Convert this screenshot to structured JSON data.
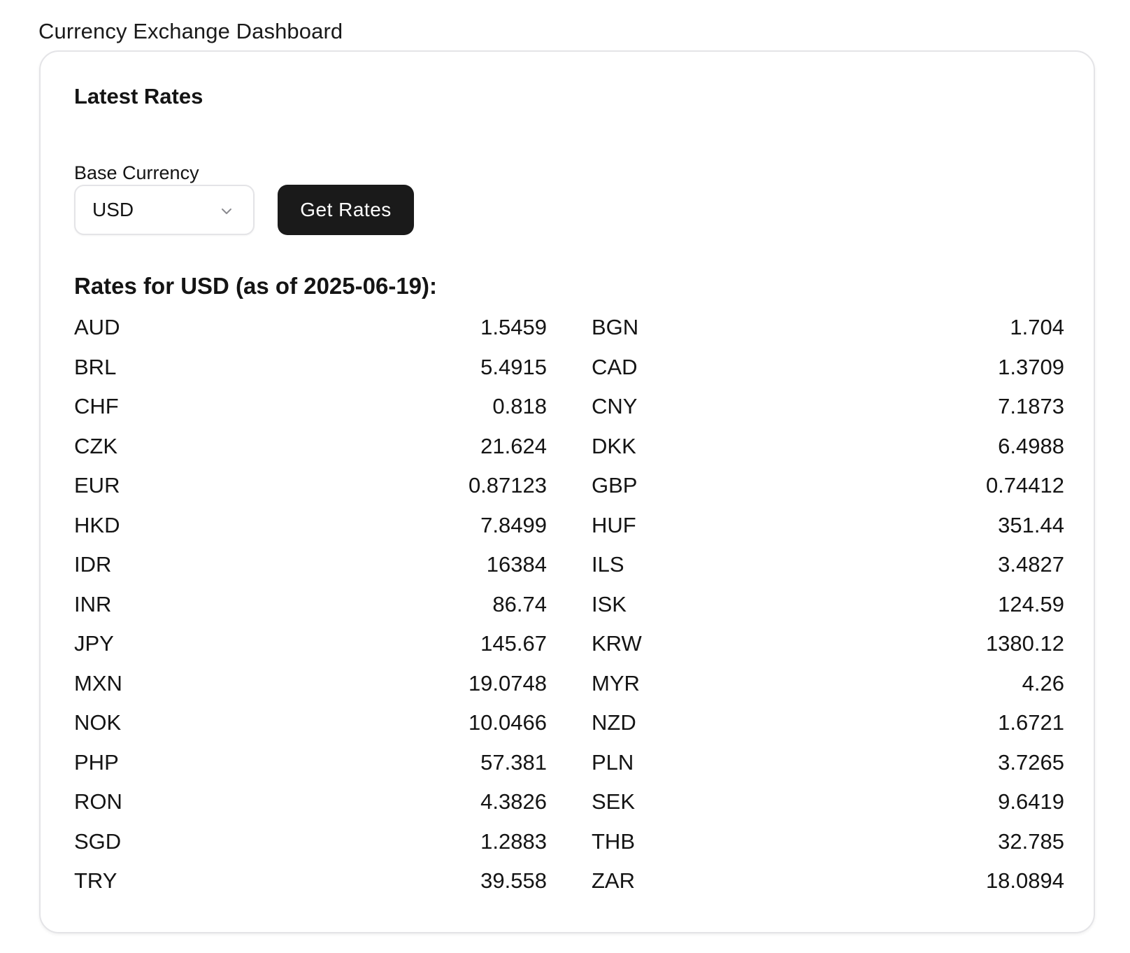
{
  "page": {
    "title": "Currency Exchange Dashboard"
  },
  "card": {
    "title": "Latest Rates",
    "base_currency_label": "Base Currency",
    "selected_currency": "USD",
    "get_rates_button": "Get Rates",
    "rates_heading": "Rates for USD (as of 2025-06-19):"
  },
  "rates": [
    {
      "code": "AUD",
      "value": "1.5459"
    },
    {
      "code": "BGN",
      "value": "1.704"
    },
    {
      "code": "BRL",
      "value": "5.4915"
    },
    {
      "code": "CAD",
      "value": "1.3709"
    },
    {
      "code": "CHF",
      "value": "0.818"
    },
    {
      "code": "CNY",
      "value": "7.1873"
    },
    {
      "code": "CZK",
      "value": "21.624"
    },
    {
      "code": "DKK",
      "value": "6.4988"
    },
    {
      "code": "EUR",
      "value": "0.87123"
    },
    {
      "code": "GBP",
      "value": "0.74412"
    },
    {
      "code": "HKD",
      "value": "7.8499"
    },
    {
      "code": "HUF",
      "value": "351.44"
    },
    {
      "code": "IDR",
      "value": "16384"
    },
    {
      "code": "ILS",
      "value": "3.4827"
    },
    {
      "code": "INR",
      "value": "86.74"
    },
    {
      "code": "ISK",
      "value": "124.59"
    },
    {
      "code": "JPY",
      "value": "145.67"
    },
    {
      "code": "KRW",
      "value": "1380.12"
    },
    {
      "code": "MXN",
      "value": "19.0748"
    },
    {
      "code": "MYR",
      "value": "4.26"
    },
    {
      "code": "NOK",
      "value": "10.0466"
    },
    {
      "code": "NZD",
      "value": "1.6721"
    },
    {
      "code": "PHP",
      "value": "57.381"
    },
    {
      "code": "PLN",
      "value": "3.7265"
    },
    {
      "code": "RON",
      "value": "4.3826"
    },
    {
      "code": "SEK",
      "value": "9.6419"
    },
    {
      "code": "SGD",
      "value": "1.2883"
    },
    {
      "code": "THB",
      "value": "32.785"
    },
    {
      "code": "TRY",
      "value": "39.558"
    },
    {
      "code": "ZAR",
      "value": "18.0894"
    }
  ],
  "icons": {
    "select_chevron": "chevron-down-icon"
  },
  "colors": {
    "button_bg": "#1a1a1a",
    "button_text": "#ffffff",
    "border": "#e4e4e7",
    "text": "#141414"
  }
}
